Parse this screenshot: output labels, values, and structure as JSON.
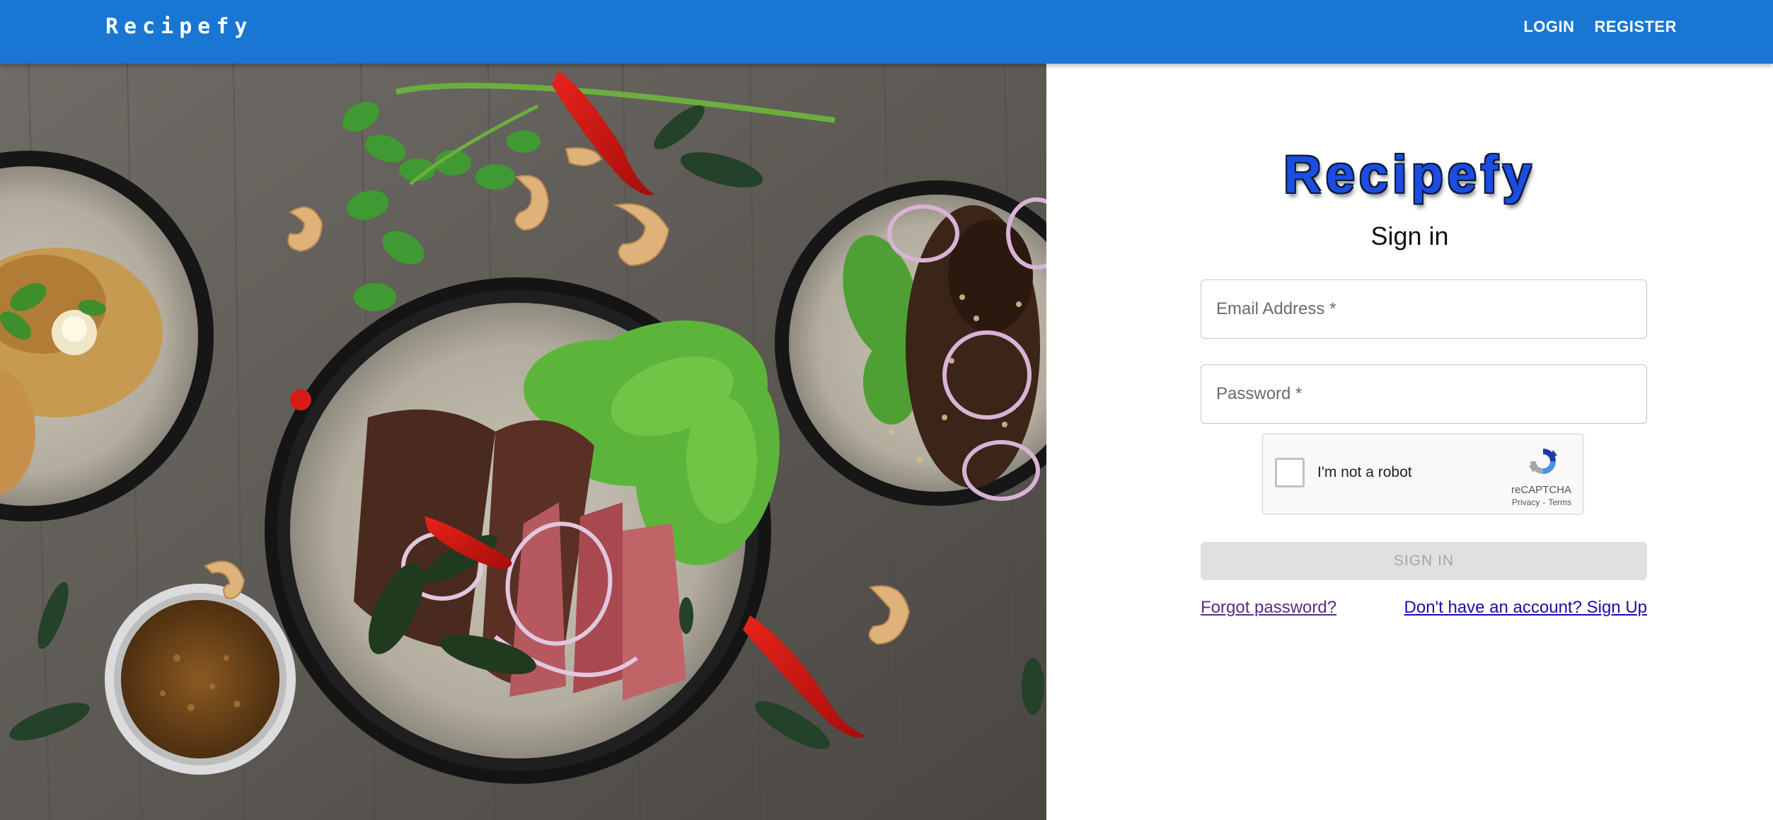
{
  "appbar": {
    "brand": "Recipefy",
    "nav": {
      "login": "LOGIN",
      "register": "REGISTER"
    },
    "color": "#1976d2"
  },
  "hero": {
    "icon": "food-photo-image"
  },
  "signin": {
    "logo": "Recipefy",
    "heading": "Sign in",
    "email": {
      "placeholder": "Email Address *",
      "value": ""
    },
    "password": {
      "placeholder": "Password *",
      "value": ""
    },
    "captcha": {
      "label": "I'm not a robot",
      "brand": "reCAPTCHA",
      "privacy": "Privacy",
      "separator": "-",
      "terms": "Terms",
      "checked": false
    },
    "submit_label": "SIGN IN",
    "forgot_label": "Forgot password?",
    "signup_label": "Don't have an account? Sign Up"
  }
}
